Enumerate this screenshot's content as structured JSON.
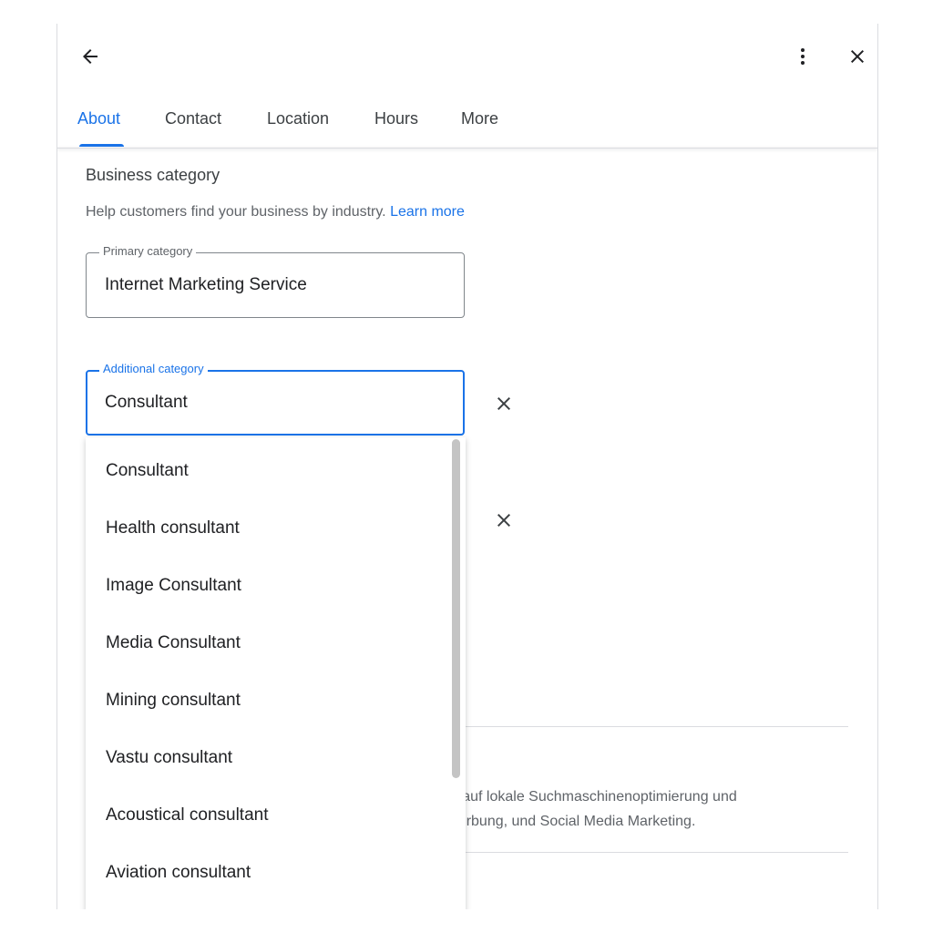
{
  "header": {
    "back_icon": "arrow-left-icon",
    "more_icon": "more-vert-icon",
    "close_icon": "close-icon"
  },
  "tabs": [
    {
      "label": "About",
      "active": true
    },
    {
      "label": "Contact",
      "active": false
    },
    {
      "label": "Location",
      "active": false
    },
    {
      "label": "Hours",
      "active": false
    },
    {
      "label": "More",
      "active": false
    }
  ],
  "business_category": {
    "title": "Business category",
    "help_text": "Help customers find your business by industry.",
    "learn_more": "Learn more",
    "primary": {
      "label": "Primary category",
      "value": "Internet Marketing Service"
    },
    "additional": {
      "label": "Additional category",
      "value": "Consultant"
    }
  },
  "background_description": {
    "line1": "rt auf lokale Suchmaschinenoptimierung und",
    "line2": "Verbung, und Social Media Marketing."
  },
  "dropdown": {
    "options": [
      "Consultant",
      "Health consultant",
      "Image Consultant",
      "Media Consultant",
      "Mining consultant",
      "Vastu consultant",
      "Acoustical consultant",
      "Aviation consultant"
    ]
  },
  "colors": {
    "accent": "#1a73e8",
    "text": "#202124",
    "muted": "#5f6368"
  }
}
